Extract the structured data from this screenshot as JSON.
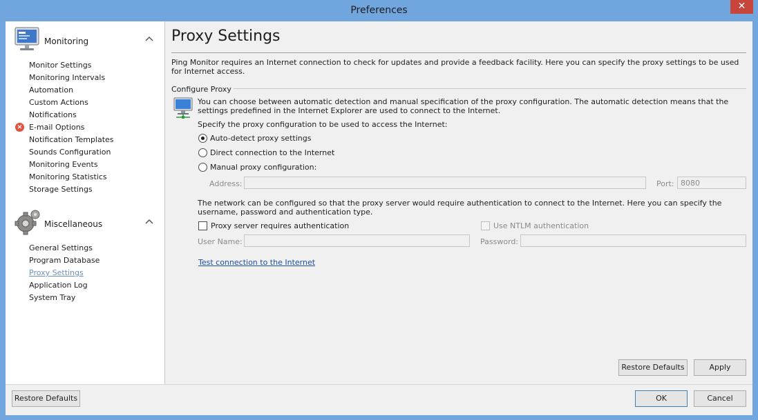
{
  "window": {
    "title": "Preferences",
    "close_glyph": "✕"
  },
  "sidebar": {
    "groups": [
      {
        "title": "Monitoring",
        "icon": "monitor-icon",
        "items": [
          {
            "label": "Monitor Settings"
          },
          {
            "label": "Monitoring Intervals"
          },
          {
            "label": "Automation"
          },
          {
            "label": "Custom Actions"
          },
          {
            "label": "Notifications"
          },
          {
            "label": "E-mail Options",
            "status": "error"
          },
          {
            "label": "Notification Templates"
          },
          {
            "label": "Sounds Configuration"
          },
          {
            "label": "Monitoring Events"
          },
          {
            "label": "Monitoring Statistics"
          },
          {
            "label": "Storage Settings"
          }
        ]
      },
      {
        "title": "Miscellaneous",
        "icon": "gears-icon",
        "items": [
          {
            "label": "General Settings"
          },
          {
            "label": "Program Database"
          },
          {
            "label": "Proxy Settings",
            "selected": true
          },
          {
            "label": "Application Log"
          },
          {
            "label": "System Tray"
          }
        ]
      }
    ]
  },
  "content": {
    "title": "Proxy Settings",
    "intro": "Ping Monitor requires an Internet connection to check for updates and provide a feedback facility. Here you can specify the proxy settings to be used for Internet access.",
    "section_label": "Configure Proxy",
    "description": "You can choose between automatic detection and manual specification of the proxy configuration. The automatic detection means that the settings predefined in the Internet Explorer are used to connect to the Internet.",
    "specify_label": "Specify the proxy configuration to be used to access the Internet:",
    "options": [
      {
        "label": "Auto-detect proxy settings",
        "checked": true
      },
      {
        "label": "Direct connection to the Internet",
        "checked": false
      },
      {
        "label": "Manual proxy configuration:",
        "checked": false
      }
    ],
    "address_label": "Address:",
    "address_value": "",
    "port_label": "Port:",
    "port_value": "8080",
    "auth_description": "The network can be configured so that the proxy server would require authentication to connect to the Internet. Here you can specify the username, password and authentication type.",
    "require_auth_label": "Proxy server requires authentication",
    "require_auth_checked": false,
    "ntlm_label": "Use NTLM authentication",
    "ntlm_checked": false,
    "username_label": "User Name:",
    "username_value": "",
    "password_label": "Password:",
    "password_value": "",
    "test_link": "Test connection to the Internet",
    "restore_defaults_label": "Restore Defaults",
    "apply_label": "Apply"
  },
  "footer": {
    "restore_defaults_label": "Restore Defaults",
    "ok_label": "OK",
    "cancel_label": "Cancel"
  }
}
